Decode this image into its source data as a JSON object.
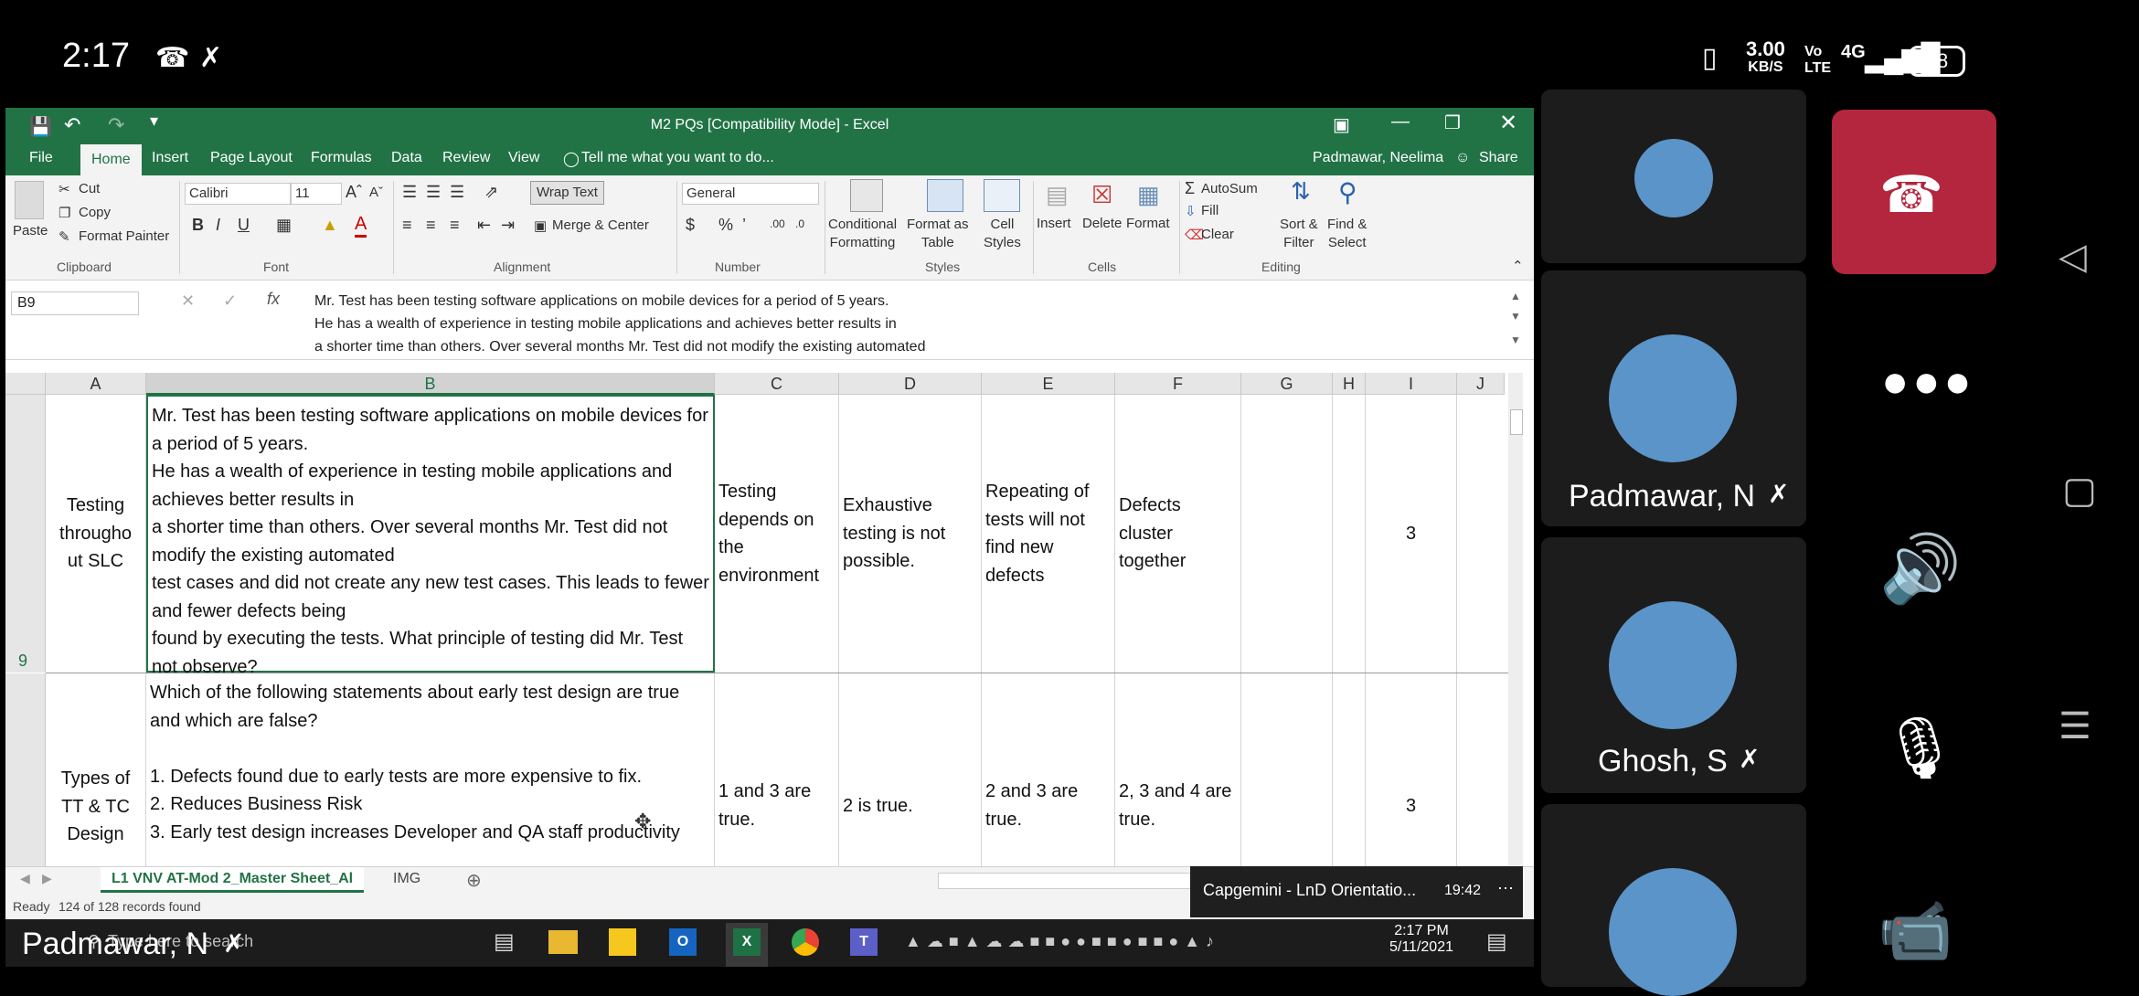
{
  "status_bar": {
    "time": "2:17",
    "speed_value": "3.00",
    "speed_unit": "KB/S",
    "volte": "Vo LTE",
    "network": "4G",
    "battery": "78"
  },
  "excel": {
    "title": "M2 PQs  [Compatibility Mode] - Excel",
    "user": "Padmawar, Neelima",
    "share": "Share",
    "tabs": [
      "File",
      "Home",
      "Insert",
      "Page Layout",
      "Formulas",
      "Data",
      "Review",
      "View"
    ],
    "tell_me": "Tell me what you want to do...",
    "ribbon": {
      "clipboard": {
        "paste": "Paste",
        "cut": "Cut",
        "copy": "Copy",
        "format_painter": "Format Painter",
        "label": "Clipboard"
      },
      "font": {
        "name": "Calibri",
        "size": "11",
        "label": "Font"
      },
      "alignment": {
        "wrap": "Wrap Text",
        "merge": "Merge & Center",
        "label": "Alignment"
      },
      "number": {
        "format": "General",
        "label": "Number"
      },
      "styles": {
        "conditional": "Conditional\nFormatting",
        "format_table": "Format as\nTable",
        "cell_styles": "Cell\nStyles",
        "label": "Styles"
      },
      "cells": {
        "insert": "Insert",
        "delete": "Delete",
        "format": "Format",
        "label": "Cells"
      },
      "editing": {
        "autosum": "AutoSum",
        "fill": "Fill",
        "clear": "Clear",
        "sort": "Sort &\nFilter",
        "find": "Find &\nSelect",
        "label": "Editing"
      }
    },
    "name_box": "B9",
    "formula_lines": [
      "Mr. Test has been testing software applications on mobile devices for a period of 5 years.",
      "He has a wealth of experience in testing mobile applications and achieves better results in",
      "a shorter time than others. Over several months Mr. Test did not modify the existing automated"
    ],
    "columns": [
      "A",
      "B",
      "C",
      "D",
      "E",
      "F",
      "G",
      "H",
      "I",
      "J"
    ],
    "rows": [
      {
        "row_num": "9",
        "a": "Testing througho ut SLC",
        "b": "Mr. Test has been testing software applications on mobile devices for a period of 5 years.\nHe has a wealth of experience in testing mobile applications and achieves better results in\na shorter time than others. Over several months Mr. Test did not modify the existing automated\ntest cases and did not create any new test cases. This leads to fewer and fewer defects being\nfound by executing the tests. What principle of testing did Mr. Test not observe?",
        "c": "Testing depends on the environment",
        "d": "Exhaustive testing is not possible.",
        "e": "Repeating of tests will not find new defects",
        "f": "Defects cluster together",
        "i": "3"
      },
      {
        "row_num": "",
        "a": "Types of TT & TC Design",
        "b": "Which of the following statements about early test design are true and which are false?\n\n1. Defects found due to early tests are more expensive to fix.\n2. Reduces Business Risk\n3. Early test design increases Developer and QA staff productivity",
        "c": "1 and 3 are true.",
        "d": "2 is true.",
        "e": "2 and 3 are true.",
        "f": "2, 3 and 4 are true.",
        "i": "3"
      }
    ],
    "sheet_tabs": [
      "L1 VNV AT-Mod 2_Master Sheet_Al",
      "IMG"
    ],
    "status": "Ready",
    "records": "124 of 128 records found"
  },
  "notification": {
    "text": "Capgemini - LnD Orientatio...",
    "time": "19:42"
  },
  "taskbar": {
    "search_placeholder": "Type here to search",
    "clock_time": "2:17 PM",
    "clock_date": "5/11/2021"
  },
  "call": {
    "self_label": "Padmawar, N",
    "participants": [
      "Padmawar, N",
      "Ghosh, S"
    ]
  }
}
